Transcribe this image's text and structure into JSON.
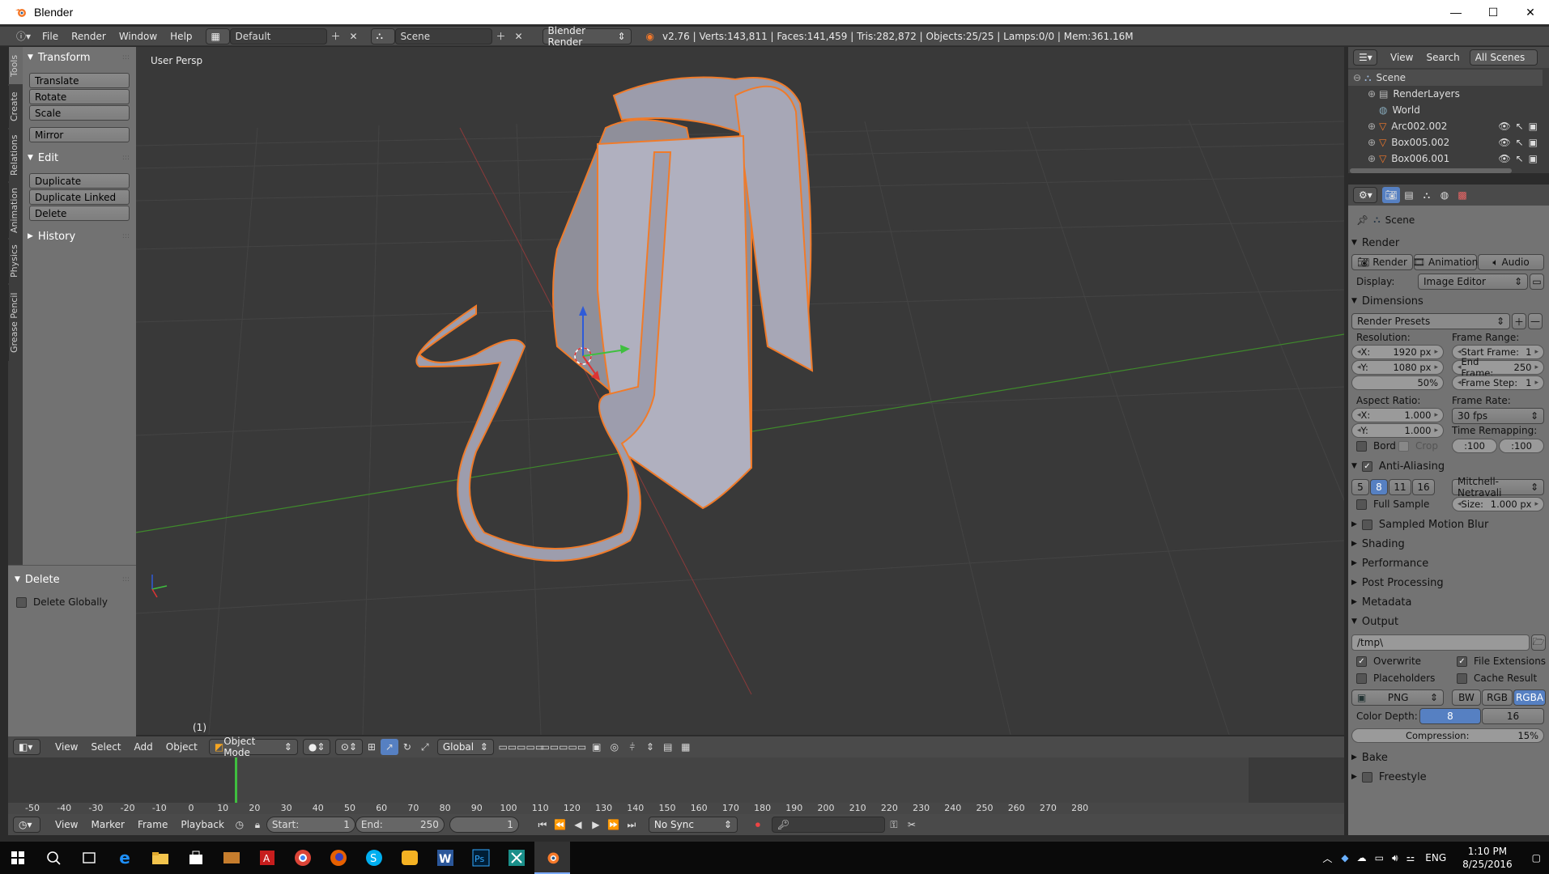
{
  "window": {
    "title": "Blender",
    "minimize": "—",
    "maximize": "☐",
    "close": "✕"
  },
  "info": {
    "menus": [
      "File",
      "Render",
      "Window",
      "Help"
    ],
    "layout": "Default",
    "scene": "Scene",
    "engine": "Blender Render",
    "stats": "v2.76 | Verts:143,811 | Faces:141,459 | Tris:282,872 | Objects:25/25 | Lamps:0/0 | Mem:361.16M"
  },
  "toolshelf": {
    "tabs": [
      "Tools",
      "Create",
      "Relations",
      "Animation",
      "Physics",
      "Grease Pencil"
    ],
    "transform": {
      "title": "Transform",
      "buttons": [
        "Translate",
        "Rotate",
        "Scale",
        "Mirror"
      ]
    },
    "edit": {
      "title": "Edit",
      "buttons": [
        "Duplicate",
        "Duplicate Linked",
        "Delete"
      ]
    },
    "history": {
      "title": "History"
    },
    "operator": {
      "title": "Delete",
      "option": "Delete Globally"
    }
  },
  "viewport": {
    "label": "User Persp",
    "frame": "(1)"
  },
  "viewport_header": {
    "menus": [
      "View",
      "Select",
      "Add",
      "Object"
    ],
    "mode": "Object Mode",
    "orientation": "Global"
  },
  "timeline": {
    "ticks": [
      "-50",
      "-40",
      "-30",
      "-20",
      "-10",
      "0",
      "10",
      "20",
      "30",
      "40",
      "50",
      "60",
      "70",
      "80",
      "90",
      "100",
      "110",
      "120",
      "130",
      "140",
      "150",
      "160",
      "170",
      "180",
      "190",
      "200",
      "210",
      "220",
      "230",
      "240",
      "250",
      "260",
      "270",
      "280"
    ],
    "menus": [
      "View",
      "Marker",
      "Frame",
      "Playback"
    ],
    "start_label": "Start:",
    "start": "1",
    "end_label": "End:",
    "end": "250",
    "current": "1",
    "sync": "No Sync"
  },
  "outliner": {
    "menus": [
      "View",
      "Search"
    ],
    "filter": "All Scenes",
    "items": [
      {
        "label": "Scene",
        "level": 0
      },
      {
        "label": "RenderLayers",
        "level": 1
      },
      {
        "label": "World",
        "level": 1
      },
      {
        "label": "Arc002.002",
        "level": 1
      },
      {
        "label": "Box005.002",
        "level": 1
      },
      {
        "label": "Box006.001",
        "level": 1
      }
    ]
  },
  "properties": {
    "context": "Scene",
    "render": {
      "title": "Render",
      "buttons": [
        "Render",
        "Animation",
        "Audio"
      ],
      "display_label": "Display:",
      "display_value": "Image Editor"
    },
    "dimensions": {
      "title": "Dimensions",
      "presets": "Render Presets",
      "resolution_label": "Resolution:",
      "res_x": "X:",
      "res_x_val": "1920 px",
      "res_y": "Y:",
      "res_y_val": "1080 px",
      "res_pct": "50%",
      "aspect_label": "Aspect Ratio:",
      "asp_x": "X:",
      "asp_x_val": "1.000",
      "asp_y": "Y:",
      "asp_y_val": "1.000",
      "bord": "Bord",
      "crop": "Crop",
      "frame_range_label": "Frame Range:",
      "start_frame": "Start Frame:",
      "start_frame_val": "1",
      "end_frame": "End Frame:",
      "end_frame_val": "250",
      "frame_step": "Frame Step:",
      "frame_step_val": "1",
      "frame_rate_label": "Frame Rate:",
      "frame_rate": "30 fps",
      "time_remap_label": "Time Remapping:",
      "remap_old": ":100",
      "remap_new": ":100"
    },
    "anti_aliasing": {
      "title": "Anti-Aliasing",
      "samples": [
        "5",
        "8",
        "11",
        "16"
      ],
      "filter": "Mitchell-Netravali",
      "full_sample": "Full Sample",
      "size_label": "Size:",
      "size_val": "1.000 px"
    },
    "collapsed": [
      "Sampled Motion Blur",
      "Shading",
      "Performance",
      "Post Processing",
      "Metadata"
    ],
    "output": {
      "title": "Output",
      "path": "/tmp\\",
      "overwrite": "Overwrite",
      "file_ext": "File Extensions",
      "placeholders": "Placeholders",
      "cache": "Cache Result",
      "format": "PNG",
      "channels": [
        "BW",
        "RGB",
        "RGBA"
      ],
      "depth_label": "Color Depth:",
      "depths": [
        "8",
        "16"
      ],
      "compression_label": "Compression:",
      "compression_val": "15%"
    },
    "bottom": [
      "Bake",
      "Freestyle"
    ]
  },
  "taskbar": {
    "lang": "ENG",
    "time": "1:10 PM",
    "date": "8/25/2016"
  },
  "colors": {
    "accent": "#5680c2",
    "selection": "#f07b2a",
    "viewport": "#393939"
  }
}
